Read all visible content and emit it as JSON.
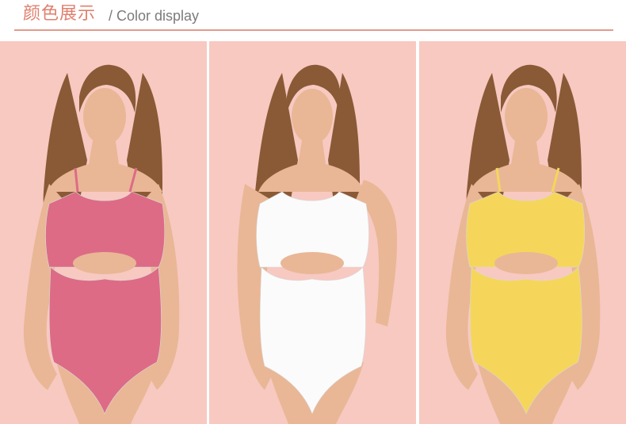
{
  "header": {
    "title_cn": "颜色展示",
    "title_en": "/ Color display"
  },
  "colors": {
    "accent": "#e0806e",
    "divider": "#e39a8a",
    "background_panel": "#f7c9c1"
  },
  "panels": [
    {
      "swimsuit_color": "#dd6b86",
      "icon": "pink-swimsuit-photo"
    },
    {
      "swimsuit_color": "#fbfbfb",
      "icon": "white-swimsuit-photo"
    },
    {
      "swimsuit_color": "#f5d65b",
      "icon": "yellow-swimsuit-photo"
    }
  ]
}
